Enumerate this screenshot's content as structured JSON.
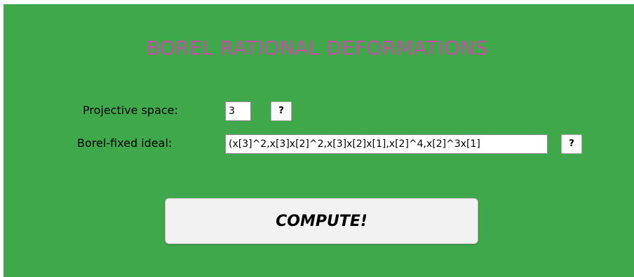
{
  "app": {
    "title": "BOREL RATIONAL DEFORMATIONS"
  },
  "form": {
    "projective_space": {
      "label": "Projective space:",
      "value": "3",
      "help_label": "?"
    },
    "borel_ideal": {
      "label": "Borel-fixed ideal:",
      "value": "(x[3]^2,x[3]x[2]^2,x[3]x[2]x[1],x[2]^4,x[2]^3x[1]",
      "help_label": "?"
    }
  },
  "actions": {
    "compute_label": "COMPUTE!"
  },
  "colors": {
    "background": "#3ea84a",
    "title": "#c64fa6"
  }
}
